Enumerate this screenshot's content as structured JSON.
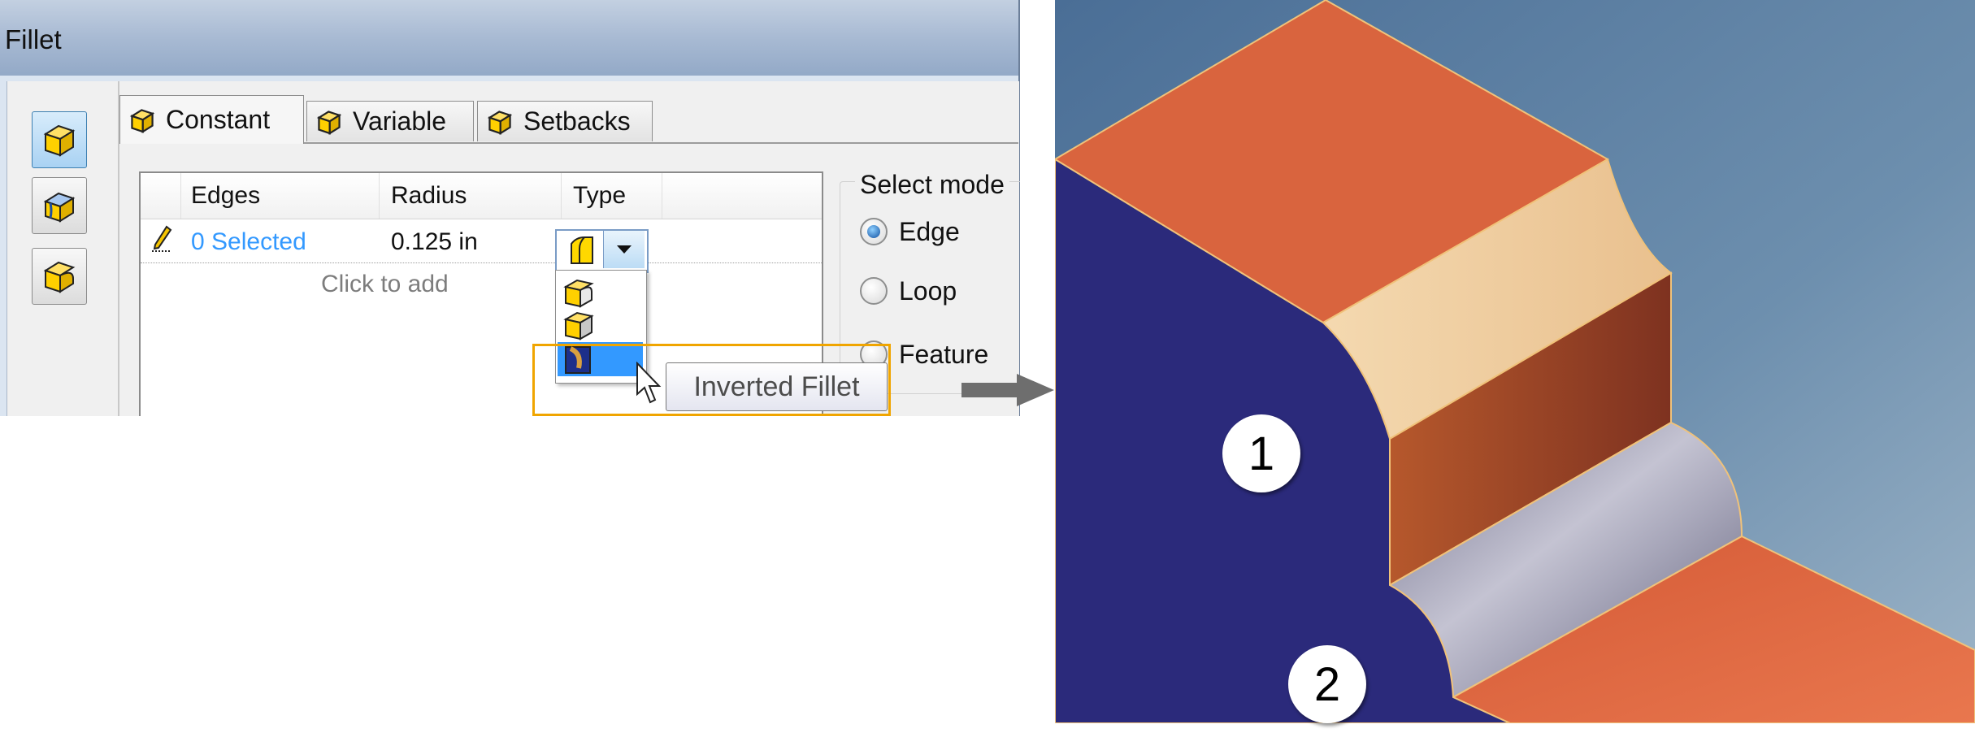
{
  "dialog": {
    "title": "Fillet",
    "toolbar_buttons": [
      "edge-fillet-icon",
      "face-fillet-icon",
      "full-round-fillet-icon"
    ],
    "tabs": [
      {
        "label": "Constant",
        "icon": "constant-fillet-icon",
        "active": true
      },
      {
        "label": "Variable",
        "icon": "variable-fillet-icon",
        "active": false
      },
      {
        "label": "Setbacks",
        "icon": "setbacks-icon",
        "active": false
      }
    ],
    "grid": {
      "columns": [
        "Edges",
        "Radius",
        "Type"
      ],
      "rows": [
        {
          "edges": "0 Selected",
          "radius": "0.125 in",
          "type_icon": "fillet-type-icon"
        }
      ],
      "add_row_text": "Click to add"
    },
    "type_dropdown": {
      "items": [
        "standard-fillet-icon",
        "chamfer-fillet-icon",
        "inverted-fillet-icon"
      ],
      "highlighted_index": 2,
      "tooltip": "Inverted Fillet"
    },
    "select_mode": {
      "label": "Select mode",
      "options": [
        {
          "label": "Edge",
          "selected": true
        },
        {
          "label": "Loop",
          "selected": false
        },
        {
          "label": "Feature",
          "selected": false
        }
      ]
    }
  },
  "model": {
    "callouts": [
      "1",
      "2"
    ]
  },
  "colors": {
    "highlight": "#f0a500",
    "link_text": "#3399ff",
    "model_background_top": "#4a6e96",
    "model_face_blue": "#2b2a7b",
    "model_face_orange": "#d9643e"
  }
}
